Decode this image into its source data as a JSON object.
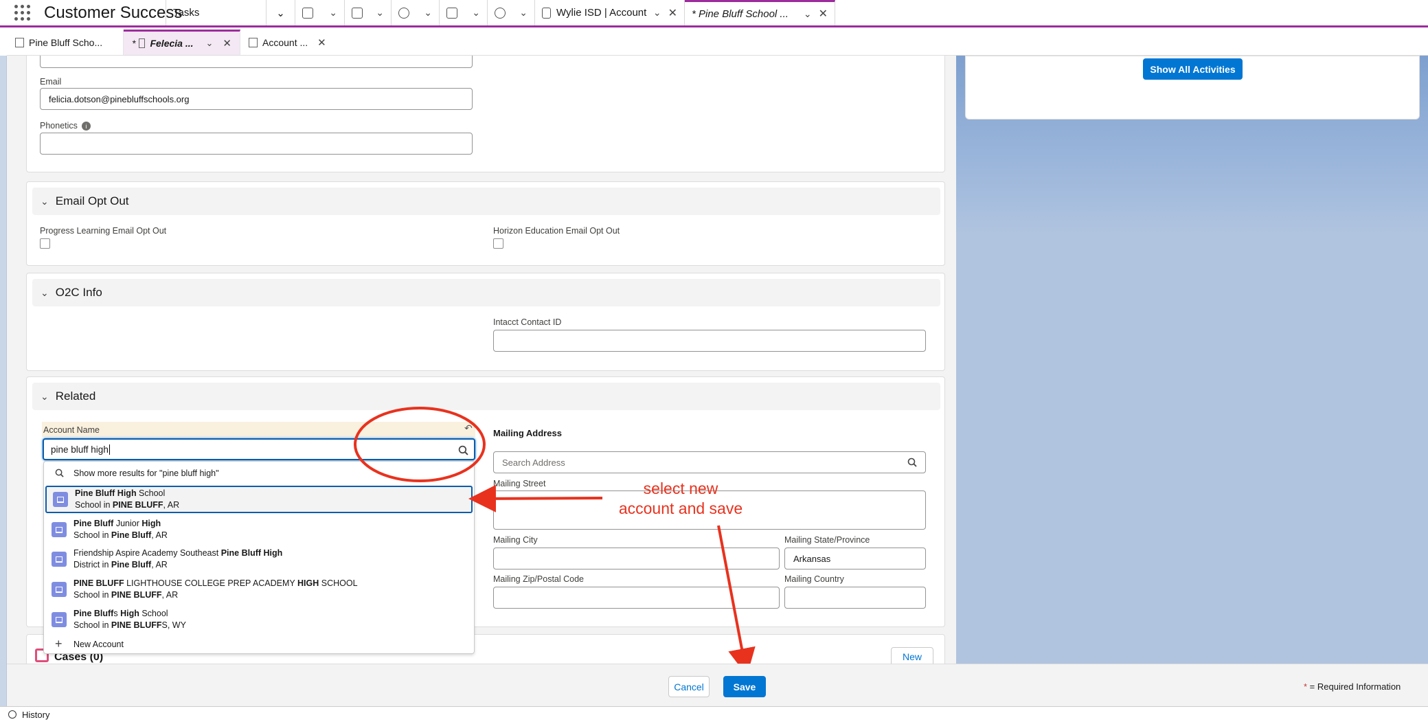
{
  "app": {
    "name": "Customer Success"
  },
  "nav": {
    "tasks_label": "Tasks",
    "tab_account_label": "Wylie ISD | Account",
    "tab_active_label": "* Pine Bluff School ..."
  },
  "subtabs": {
    "tab1": "Pine Bluff Scho...",
    "tab2_prefix": "*",
    "tab2": "Felecia ...",
    "tab3": "Account ..."
  },
  "activities": {
    "show_all": "Show All Activities"
  },
  "contact": {
    "email_label": "Email",
    "email_value": "felicia.dotson@pinebluffschools.org",
    "phonetics_label": "Phonetics",
    "phonetics_info": "i"
  },
  "sections": {
    "email_opt_out": "Email Opt Out",
    "o2c": "O2C Info",
    "related": "Related",
    "cases": "Cases (0)"
  },
  "opt_out": {
    "progress_label": "Progress Learning Email Opt Out",
    "horizon_label": "Horizon Education Email Opt Out"
  },
  "o2c": {
    "intacct_label": "Intacct Contact ID"
  },
  "related": {
    "account_label": "Account Name",
    "account_value": "pine bluff high",
    "mailing_address_label": "Mailing Address",
    "search_address_placeholder": "Search Address",
    "street_label": "Mailing Street",
    "city_label": "Mailing City",
    "state_label": "Mailing State/Province",
    "state_value": "Arkansas",
    "zip_label": "Mailing Zip/Postal Code",
    "country_label": "Mailing Country"
  },
  "dropdown": {
    "show_more": "Show more results for \"pine bluff high\"",
    "new_account": "New Account",
    "results": [
      {
        "t1": "Pine Bluff High",
        "t2": " School",
        "s1": "School in ",
        "s2": "PINE BLUFF",
        "s3": ", AR"
      },
      {
        "t1": "Pine Bluff",
        "t2": " Junior ",
        "t3": "High",
        "s1": "School in ",
        "s2": "Pine Bluff",
        "s3": ", AR"
      },
      {
        "t1": "Friendship Aspire Academy Southeast ",
        "t2": "Pine Bluff High",
        "s1": "District in ",
        "s2": "Pine Bluff",
        "s3": ", AR"
      },
      {
        "t1": "PINE BLUFF",
        "t2": " LIGHTHOUSE COLLEGE PREP ACADEMY ",
        "t3": "HIGH",
        "t4": " SCHOOL",
        "s1": "School in ",
        "s2": "PINE BLUFF",
        "s3": ", AR"
      },
      {
        "t1": "Pine Bluff",
        "t2": "s ",
        "t3": "High",
        "t4": " School",
        "s1": "School in ",
        "s2": "PINE BLUFF",
        "s3": "S, WY"
      }
    ]
  },
  "cases": {
    "new_label": "New"
  },
  "annotation": {
    "line1": "select new",
    "line2": "account and save",
    "color": "#e8321e"
  },
  "footer": {
    "cancel": "Cancel",
    "save": "Save",
    "required_star": "*",
    "required_text": " = Required Information"
  },
  "utility": {
    "history": "History"
  },
  "colors": {
    "brand": "#0176d3",
    "accent": "#9c2c9c",
    "avatar": "#7f8de1"
  }
}
